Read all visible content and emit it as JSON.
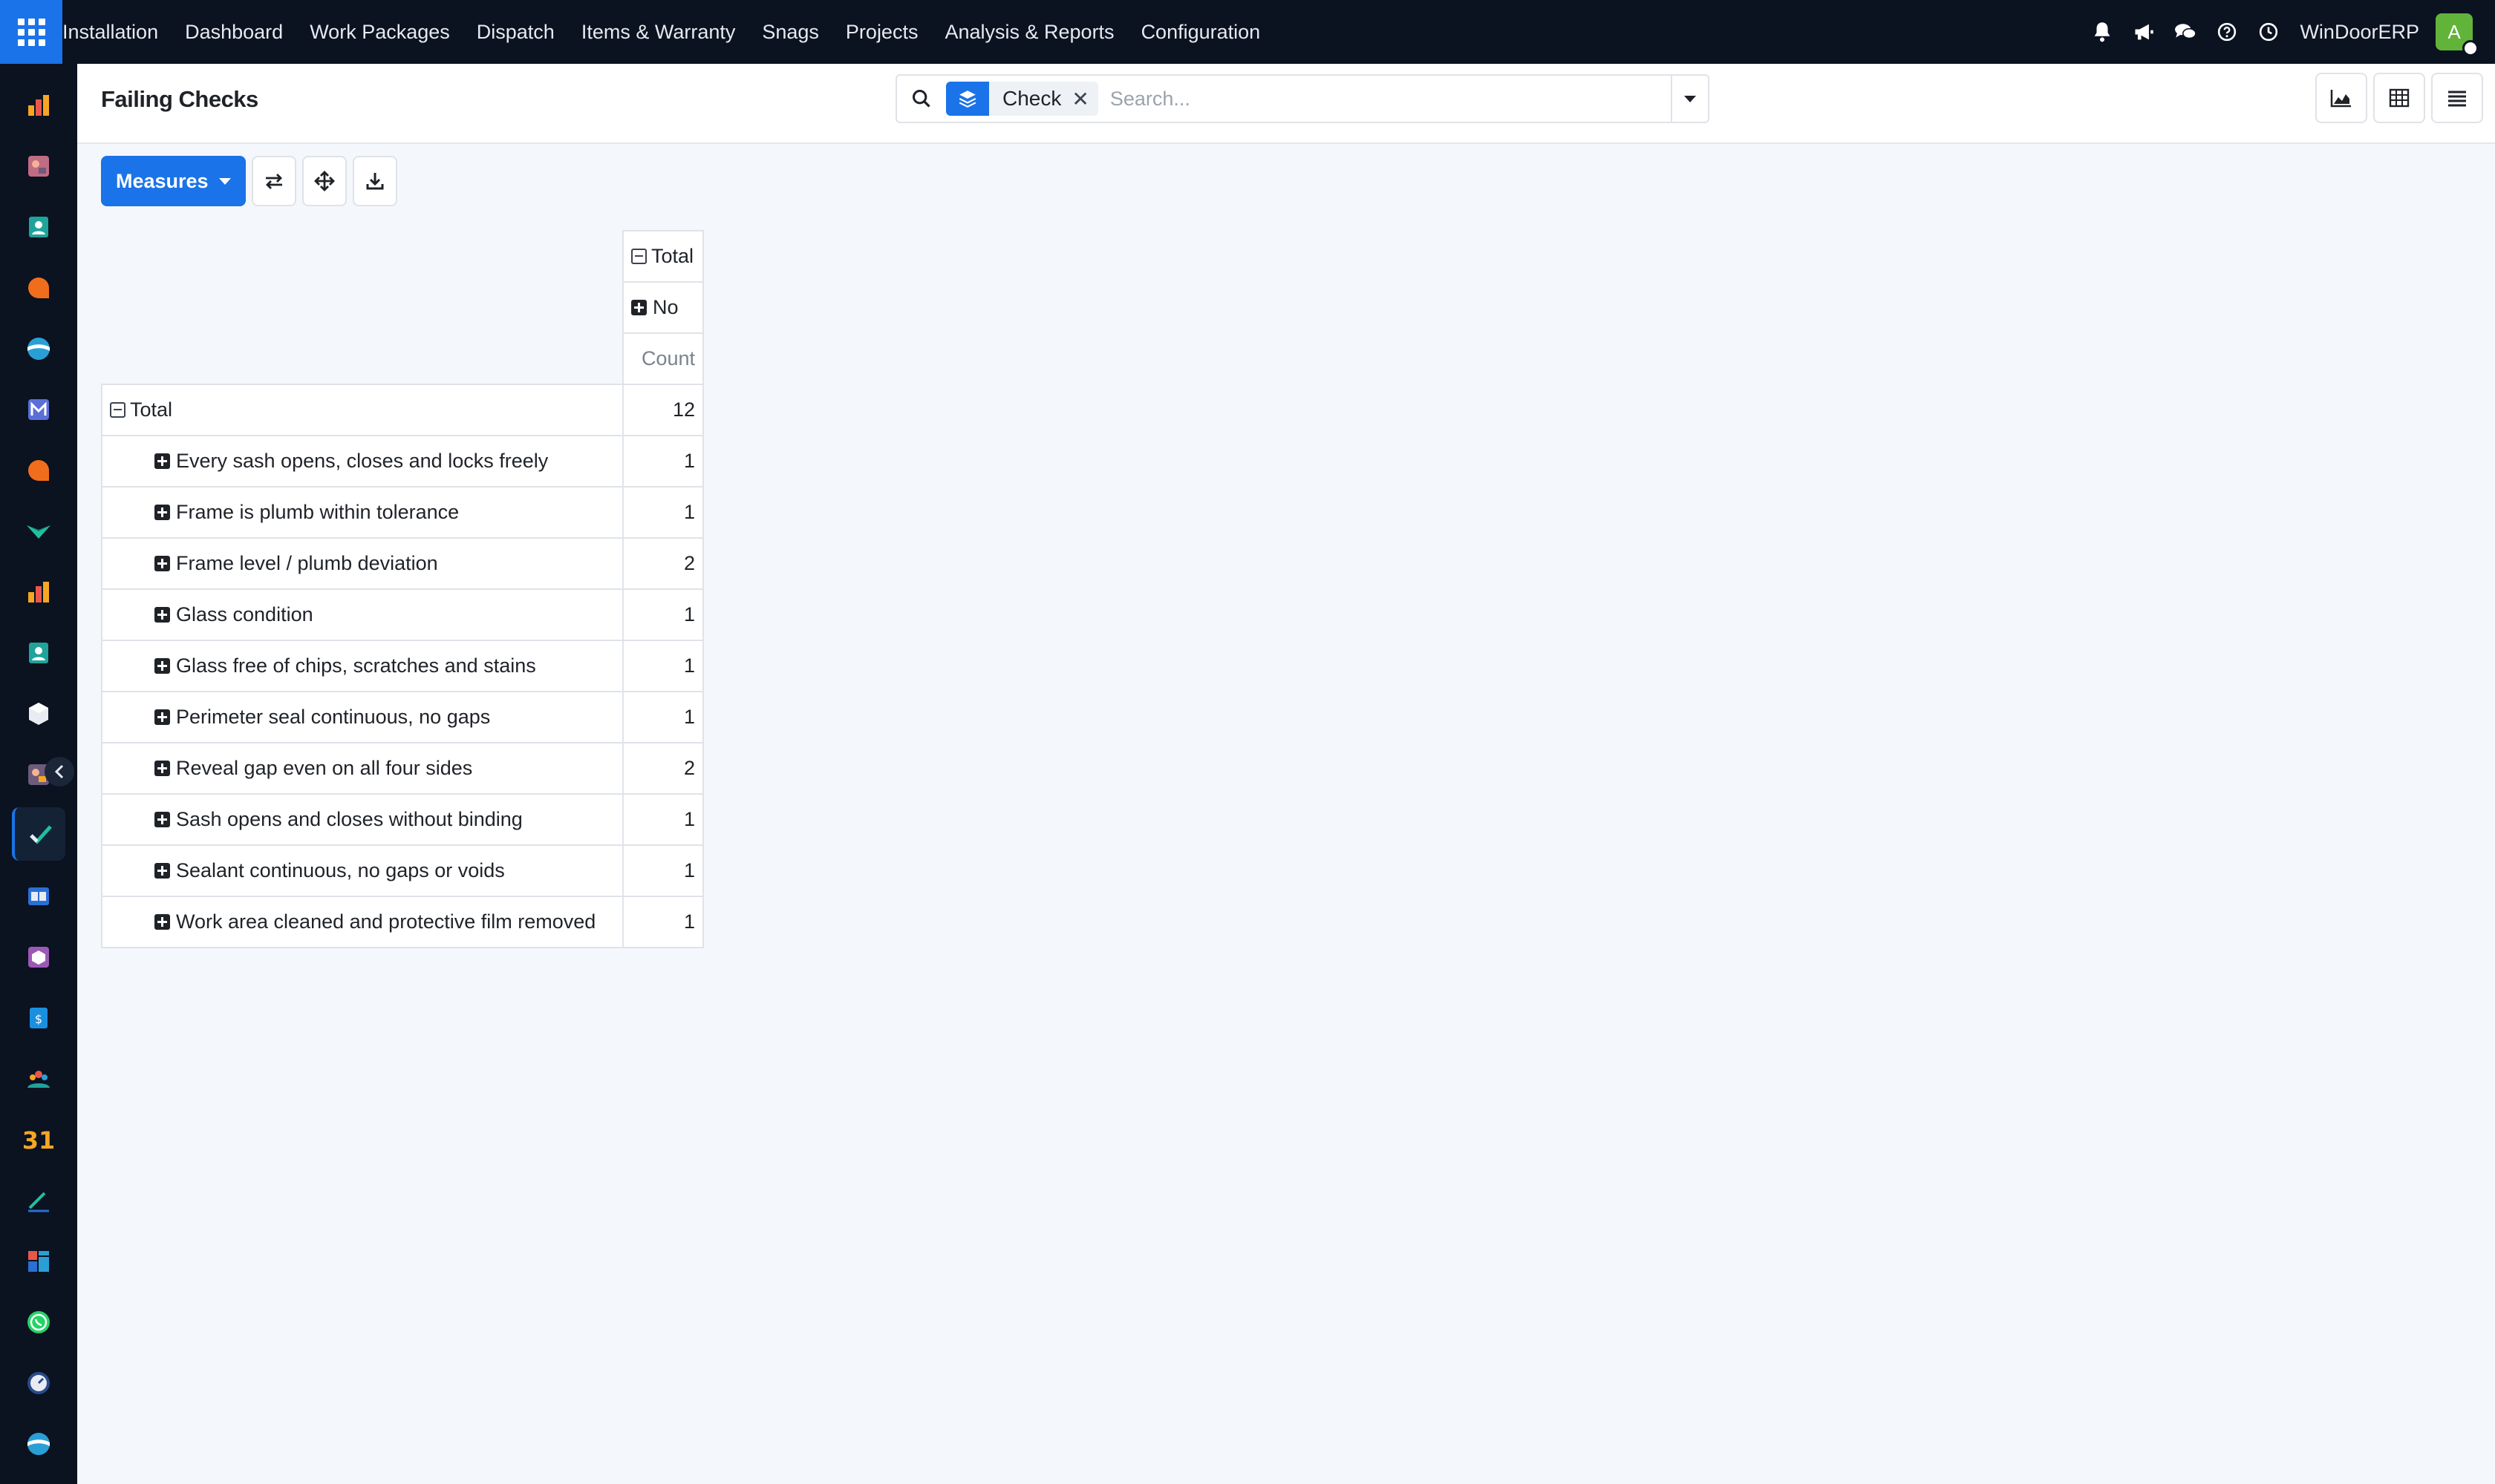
{
  "topbar": {
    "menu": [
      "Installation",
      "Dashboard",
      "Work Packages",
      "Dispatch",
      "Items & Warranty",
      "Snags",
      "Projects",
      "Analysis & Reports",
      "Configuration"
    ],
    "company": "WinDoorERP",
    "avatar_letter": "A",
    "icons": [
      "bell-icon",
      "megaphone-icon",
      "chat-icon",
      "help-icon",
      "clock-icon"
    ]
  },
  "sidebar": {
    "apps": [
      "sales-app",
      "planning-app",
      "contacts-app",
      "discuss-app",
      "crm-app",
      "email-marketing-app",
      "livechat-app",
      "project-app",
      "reporting-app",
      "employees-app",
      "inventory-app",
      "tasks-app",
      "quality-app",
      "knowledge-app",
      "packaging-app",
      "invoicing-app",
      "team-app",
      "calendar-app",
      "sign-app",
      "dashboards-app",
      "whatsapp-app",
      "timesheet-app",
      "website-app"
    ],
    "active_index": 11
  },
  "control_panel": {
    "title": "Failing Checks",
    "facet_value": "Check",
    "search_placeholder": "Search..."
  },
  "toolbar": {
    "measures_label": "Measures"
  },
  "pivot": {
    "col_total_label": "Total",
    "col_group_label": "No",
    "measure_label": "Count",
    "row_total_label": "Total",
    "row_total_value": "12",
    "rows": [
      {
        "label": "Every sash opens, closes and locks freely",
        "value": "1"
      },
      {
        "label": "Frame is plumb within tolerance",
        "value": "1"
      },
      {
        "label": "Frame level / plumb deviation",
        "value": "2"
      },
      {
        "label": "Glass condition",
        "value": "1"
      },
      {
        "label": "Glass free of chips, scratches and stains",
        "value": "1"
      },
      {
        "label": "Perimeter seal continuous, no gaps",
        "value": "1"
      },
      {
        "label": "Reveal gap even on all four sides",
        "value": "2"
      },
      {
        "label": "Sash opens and closes without binding",
        "value": "1"
      },
      {
        "label": "Sealant continuous, no gaps or voids",
        "value": "1"
      },
      {
        "label": "Work area cleaned and protective film removed",
        "value": "1"
      }
    ]
  }
}
